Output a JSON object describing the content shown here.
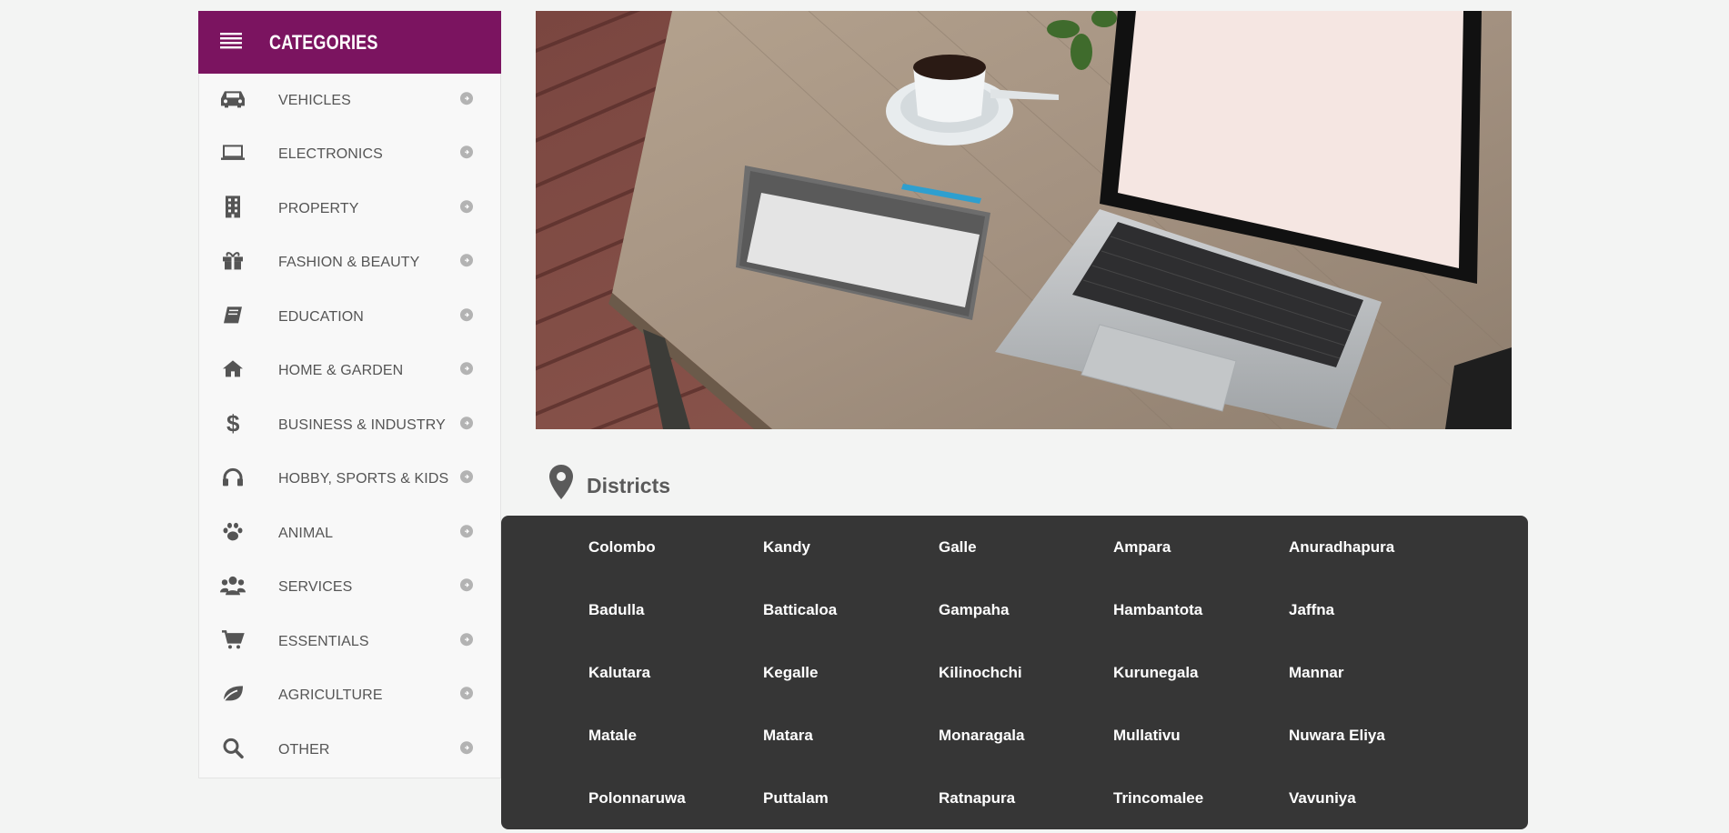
{
  "sidebar": {
    "title": "CATEGORIES",
    "menu_icon": "menu-icon",
    "items": [
      {
        "label": "VEHICLES",
        "icon": "car-icon"
      },
      {
        "label": "ELECTRONICS",
        "icon": "laptop-icon"
      },
      {
        "label": "PROPERTY",
        "icon": "building-icon"
      },
      {
        "label": "FASHION & BEAUTY",
        "icon": "gift-icon"
      },
      {
        "label": "EDUCATION",
        "icon": "book-icon"
      },
      {
        "label": "HOME & GARDEN",
        "icon": "home-icon"
      },
      {
        "label": "BUSINESS & INDUSTRY",
        "icon": "dollar-icon"
      },
      {
        "label": "HOBBY, SPORTS & KIDS",
        "icon": "headphones-icon"
      },
      {
        "label": "ANIMAL",
        "icon": "paw-icon"
      },
      {
        "label": "SERVICES",
        "icon": "users-icon"
      },
      {
        "label": "ESSENTIALS",
        "icon": "cart-icon"
      },
      {
        "label": "AGRICULTURE",
        "icon": "leaf-icon"
      },
      {
        "label": "OTHER",
        "icon": "search-icon"
      }
    ]
  },
  "districts": {
    "title": "Districts",
    "icon": "map-marker-icon",
    "items": [
      "Colombo",
      "Kandy",
      "Galle",
      "Ampara",
      "Anuradhapura",
      "Badulla",
      "Batticaloa",
      "Gampaha",
      "Hambantota",
      "Jaffna",
      "Kalutara",
      "Kegalle",
      "Kilinochchi",
      "Kurunegala",
      "Mannar",
      "Matale",
      "Matara",
      "Monaragala",
      "Mullativu",
      "Nuwara Eliya",
      "Polonnaruwa",
      "Puttalam",
      "Ratnapura",
      "Trincomalee",
      "Vavuniya"
    ]
  },
  "colors": {
    "header_bg": "#7b1460",
    "panel_bg": "#363636",
    "page_bg": "#f3f4f3"
  }
}
